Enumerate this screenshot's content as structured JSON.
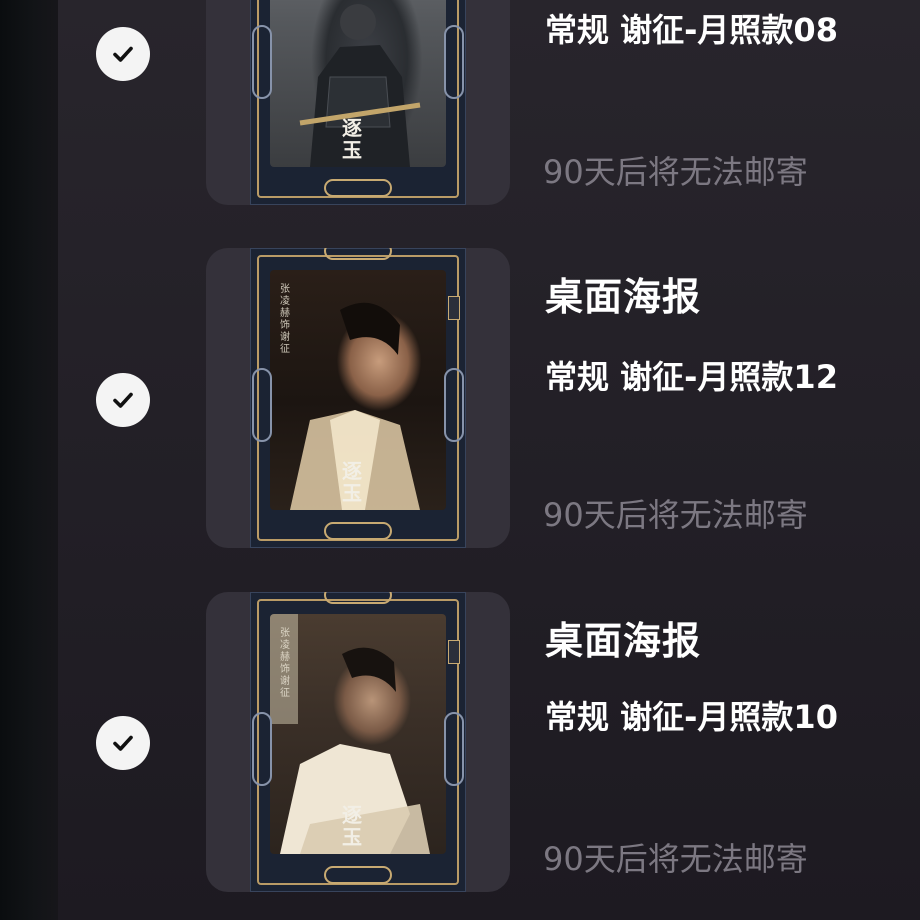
{
  "items": [
    {
      "title": "",
      "variant": "常规 谢征-月照款08",
      "note": "90天后将无法邮寄",
      "poster": {
        "name_vertical": "",
        "calligraphy": "逐玉"
      }
    },
    {
      "title": "桌面海报",
      "variant": "常规 谢征-月照款12",
      "note": "90天后将无法邮寄",
      "poster": {
        "name_vertical": "张凌赫 饰 谢征",
        "calligraphy": "逐玉"
      }
    },
    {
      "title": "桌面海报",
      "variant": "常规 谢征-月照款10",
      "note": "90天后将无法邮寄",
      "poster": {
        "name_vertical": "张凌赫 饰 谢征",
        "calligraphy": "逐玉"
      }
    }
  ],
  "colors": {
    "background": "#1e1b21",
    "thumb_box": "#34313a",
    "title_text": "#ffffff",
    "note_text": "#7c7882",
    "check_bg": "#f4f4f4",
    "poster_gold": "#c8aa72",
    "poster_navy": "#1b2333"
  },
  "icons": [
    "check-icon"
  ]
}
